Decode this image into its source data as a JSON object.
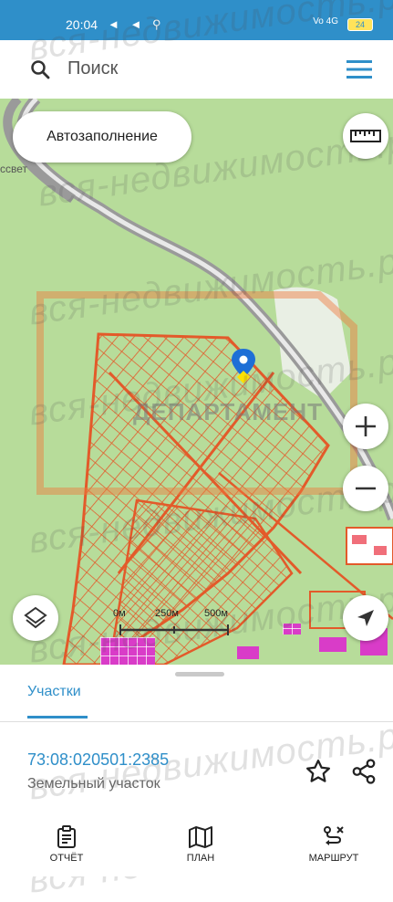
{
  "status_bar": {
    "time": "20:04",
    "icons": "◄ ◄ ⚲",
    "network": "Vo 4G",
    "battery": "24"
  },
  "search": {
    "placeholder": "Поиск"
  },
  "map": {
    "autofill_label": "Автозаполнение",
    "street_label": "ссвет",
    "overlay_label": "ДЕПАРТАМЕНТ",
    "scale": {
      "m0": "0м",
      "m250": "250м",
      "m500": "500м"
    },
    "watermark": "вся-недвижимость.рф"
  },
  "panel": {
    "tab_label": "Участки",
    "item": {
      "cadastral": "73:08:020501:2385",
      "type": "Земельный участок"
    }
  },
  "bottom_nav": {
    "report": "ОТЧЁТ",
    "plan": "ПЛАН",
    "route": "МАРШРУТ"
  },
  "colors": {
    "accent": "#2f8fc9",
    "map_green": "#b7dc9a",
    "parcel_lines": "#e35a2a"
  }
}
